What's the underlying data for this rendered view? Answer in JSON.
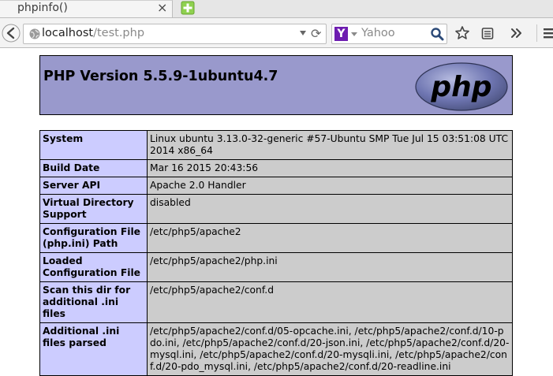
{
  "browser": {
    "tab": {
      "title": "phpinfo()",
      "close": "×"
    },
    "url": {
      "host": "localhost",
      "path": "/test.php"
    },
    "search": {
      "engine_letter": "Y",
      "placeholder": "Yahoo"
    },
    "icons": [
      "back-arrow-icon",
      "globe-icon",
      "dropdown-icon",
      "reload-icon",
      "yahoo-icon",
      "search-icon",
      "bookmark-star-icon",
      "reading-list-icon",
      "overflow-chevron-icon",
      "menu-icon",
      "new-tab-icon"
    ]
  },
  "page": {
    "title": "PHP Version 5.5.9-1ubuntu4.7",
    "logo_text": "php",
    "colors": {
      "header_bg": "#9999cc",
      "label_bg": "#ccccff",
      "value_bg": "#cccccc"
    },
    "rows": [
      {
        "label": "System",
        "value": "Linux ubuntu 3.13.0-32-generic #57-Ubuntu SMP Tue Jul 15 03:51:08 UTC 2014 x86_64"
      },
      {
        "label": "Build Date",
        "value": "Mar 16 2015 20:43:56"
      },
      {
        "label": "Server API",
        "value": "Apache 2.0 Handler"
      },
      {
        "label": "Virtual Directory Support",
        "value": "disabled"
      },
      {
        "label": "Configuration File (php.ini) Path",
        "value": "/etc/php5/apache2"
      },
      {
        "label": "Loaded Configuration File",
        "value": "/etc/php5/apache2/php.ini"
      },
      {
        "label": "Scan this dir for additional .ini files",
        "value": "/etc/php5/apache2/conf.d"
      },
      {
        "label": "Additional .ini files parsed",
        "value": "/etc/php5/apache2/conf.d/05-opcache.ini, /etc/php5/apache2/conf.d/10-pdo.ini, /etc/php5/apache2/conf.d/20-json.ini, /etc/php5/apache2/conf.d/20-mysql.ini, /etc/php5/apache2/conf.d/20-mysqli.ini, /etc/php5/apache2/conf.d/20-pdo_mysql.ini, /etc/php5/apache2/conf.d/20-readline.ini"
      }
    ]
  }
}
